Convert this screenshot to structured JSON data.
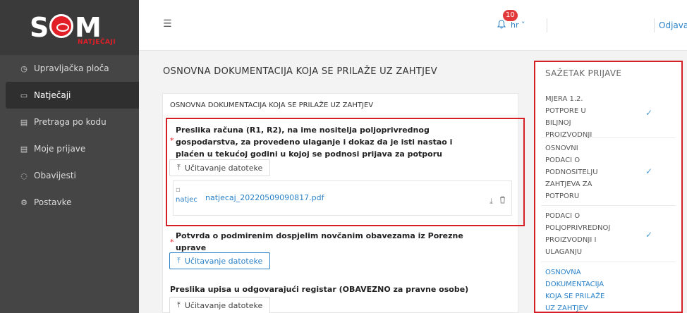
{
  "brand": {
    "logo_text_left": "S",
    "logo_text_right": "M",
    "logo_sub": "NATJEČAJI"
  },
  "sidebar": {
    "items": [
      {
        "label": "Upravljačka ploča",
        "icon": "dashboard-icon",
        "glyph": "◷"
      },
      {
        "label": "Natječaji",
        "icon": "folder-icon",
        "glyph": "▭"
      },
      {
        "label": "Pretraga po kodu",
        "icon": "document-icon",
        "glyph": "▤"
      },
      {
        "label": "Moje prijave",
        "icon": "document-edit-icon",
        "glyph": "▤"
      },
      {
        "label": "Obavijesti",
        "icon": "bell-icon",
        "glyph": "◌"
      },
      {
        "label": "Postavke",
        "icon": "gear-icon",
        "glyph": "⚙"
      }
    ],
    "active_index": 1
  },
  "header": {
    "menu_glyph": "☰",
    "notifications_count": "10",
    "bell_glyph": "◻",
    "language": "hr ˅",
    "logout_label": "Odjava"
  },
  "main": {
    "title": "OSNOVNA DOKUMENTACIJA KOJA SE PRILAŽE UZ ZAHTJEV",
    "card_header": "OSNOVNA DOKUMENTACIJA KOJA SE PRILAŽE UZ ZAHTJEV",
    "documents": [
      {
        "required": "*",
        "title_lines": [
          "Preslika računa (R1, R2), na ime nositelja poljoprivrednog",
          "gospodarstva, za provedeno ulaganje i dokaz da je isti nastao i",
          "plaćen u tekućoj godini u kojoj se podnosi prijava za potporu"
        ],
        "upload_label": "Učitavanje datoteke",
        "file": {
          "name": "natjecaj_20220509090817.pdf",
          "thumb_alt": "natjec",
          "download_glyph": "⤓",
          "delete_glyph": "🗑"
        }
      },
      {
        "required": "*",
        "title_lines": [
          "Potvrda o podmirenim dospjelim novčanim obavezama iz Porezne",
          "uprave"
        ],
        "upload_label": "Učitavanje datoteke"
      },
      {
        "title_lines": [
          "Preslika upisa u odgovarajući registar (OBAVEZNO za pravne osobe)"
        ],
        "upload_label": "Učitavanje datoteke"
      }
    ],
    "upload_glyph": "⤒"
  },
  "summary": {
    "title": "SAŽETAK PRIJAVE",
    "items": [
      {
        "lines": [
          "MJERA 1.2.",
          "POTPORE U",
          "BILJNOJ",
          "PROIZVODNJI"
        ],
        "done": true,
        "active": false
      },
      {
        "lines": [
          "OSNOVNI",
          "PODACI O",
          "PODNOSITELJU",
          "ZAHTJEVA ZA",
          "POTPORU"
        ],
        "done": true,
        "active": false
      },
      {
        "lines": [
          "PODACI O",
          "POLJOPRIVREDNOJ",
          "PROIZVODNJI I",
          "ULAGANJU"
        ],
        "done": true,
        "active": false
      },
      {
        "lines": [
          "OSNOVNA",
          "DOKUMENTACIJA",
          "KOJA SE PRILAŽE",
          "UZ ZAHTJEV"
        ],
        "done": false,
        "active": true
      }
    ],
    "check_glyph": "✓"
  }
}
